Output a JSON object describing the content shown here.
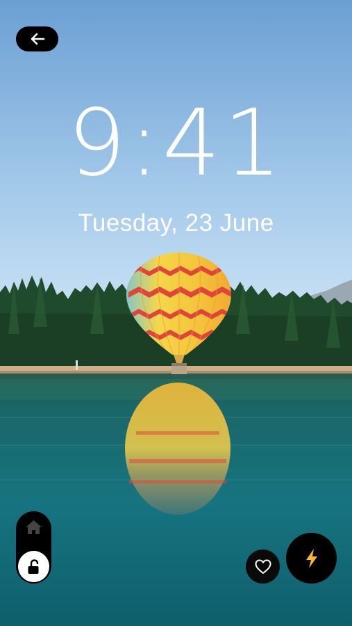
{
  "lockscreen": {
    "time": "9:41",
    "date": "Tuesday,  23 June"
  },
  "icons": {
    "back": "arrow-left-icon",
    "home": "home-icon",
    "unlock": "unlock-icon",
    "favorite": "heart-icon",
    "flash": "lightning-bolt-icon"
  },
  "colors": {
    "sky_top": "#6fa2d4",
    "sky_horizon": "#d8ebf8",
    "water": "#0e5d68",
    "button_dark": "#000000",
    "flash_accent": "#f5b731"
  }
}
